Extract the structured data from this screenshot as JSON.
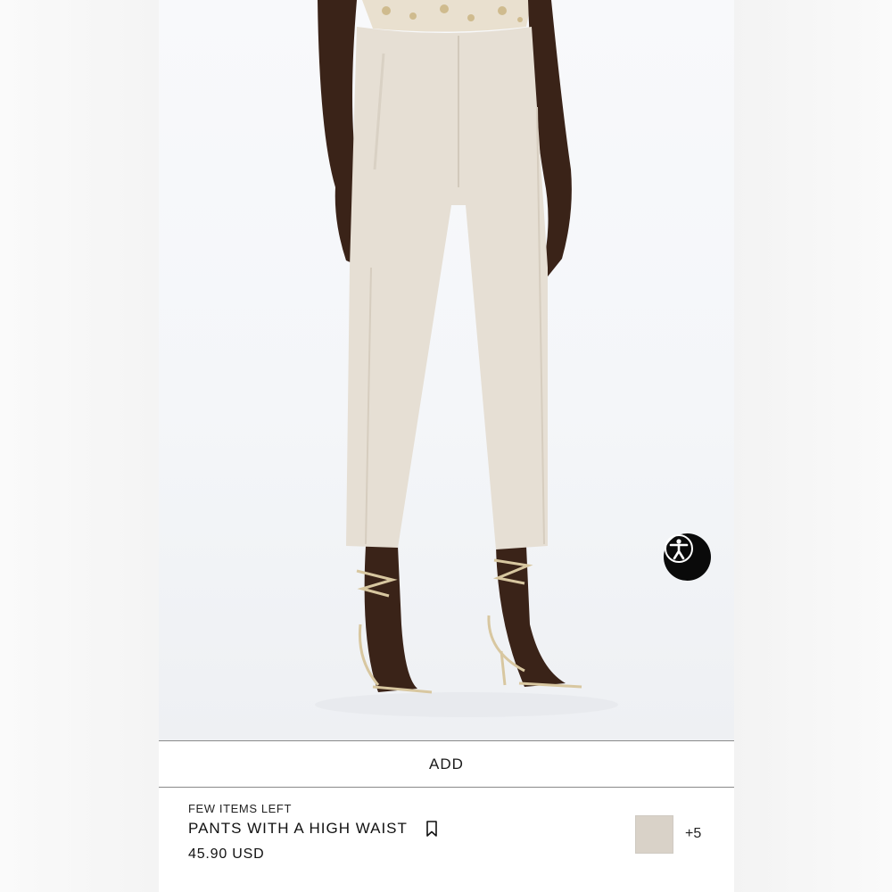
{
  "actions": {
    "add_label": "ADD"
  },
  "product": {
    "stock_status": "FEW ITEMS LEFT",
    "name": "PANTS WITH A HIGH WAIST",
    "price": "45.90 USD",
    "more_colors": "+5"
  },
  "colors": {
    "swatch": "#d9d2c8",
    "pants": "#e6dfd4",
    "skin": "#3a2318"
  },
  "icons": {
    "accessibility": "accessibility-person-icon",
    "bookmark": "bookmark-icon"
  }
}
